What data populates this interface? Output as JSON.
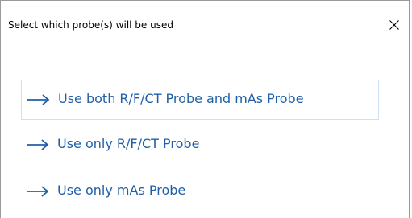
{
  "dialog": {
    "title": "Select which probe(s) will be used",
    "close_glyph": "×",
    "accent_color": "#1f5fa8"
  },
  "options": [
    {
      "label": "Use both R/F/CT Probe and mAs Probe",
      "icon": "right-arrow-icon"
    },
    {
      "label": "Use only R/F/CT Probe",
      "icon": "right-arrow-icon"
    },
    {
      "label": "Use only mAs Probe",
      "icon": "right-arrow-icon"
    }
  ]
}
